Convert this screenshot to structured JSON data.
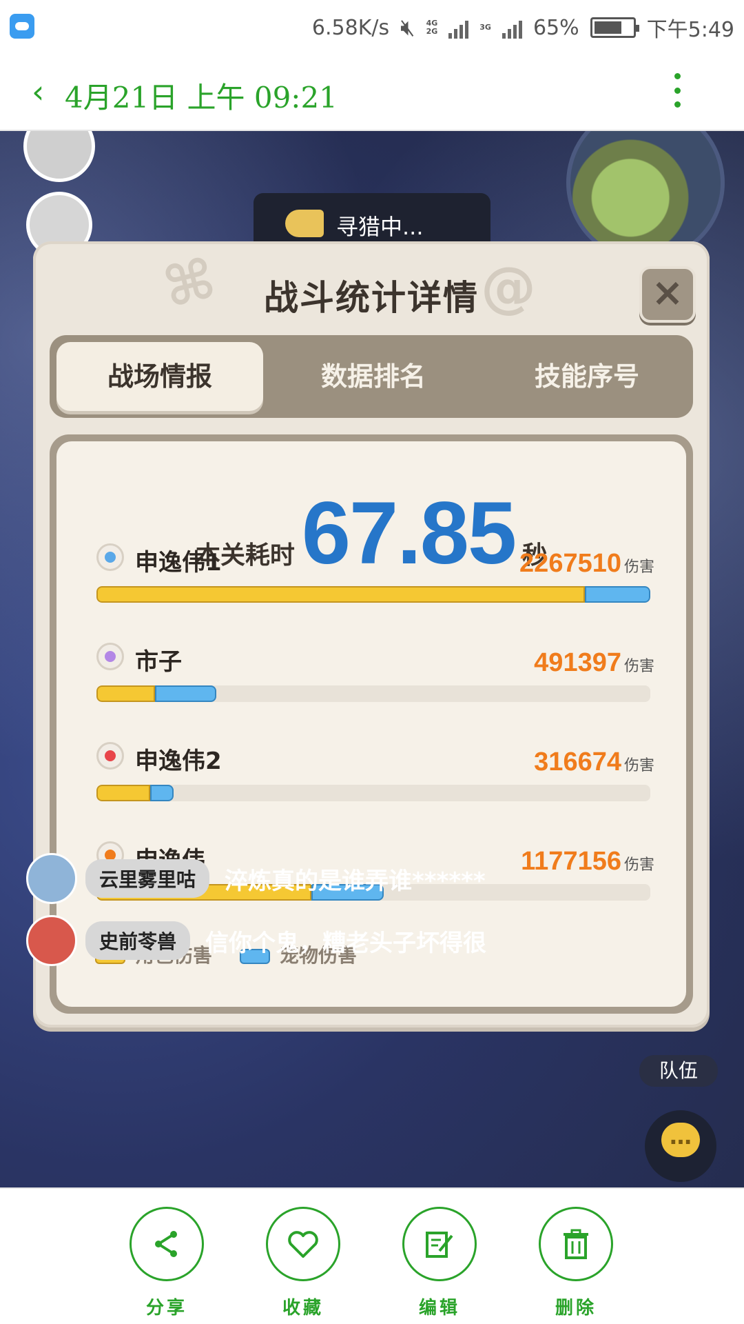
{
  "status_bar": {
    "net_speed": "6.58K/s",
    "net_type_a": "4G",
    "net_type_b": "2G",
    "net_type_c": "3G",
    "battery": "65%",
    "time": "下午5:49",
    "accent": "#555555"
  },
  "header": {
    "back_icon": "chevron-left-icon",
    "title": "4月21日 上午 09:21",
    "more_icon": "more-vertical-icon",
    "color": "#2aa32a"
  },
  "game": {
    "hunting_label": "寻猎中...",
    "team_label": "队伍",
    "chat": [
      {
        "name": "云里雾里咕",
        "message": "淬炼真的是谁弄谁******"
      },
      {
        "name": "史前苓兽",
        "message": "信你个鬼，糟老头子坏得很"
      }
    ]
  },
  "dialog": {
    "title": "战斗统计详情",
    "close_icon": "close-icon",
    "tabs": [
      {
        "label": "战场情报",
        "active": true
      },
      {
        "label": "数据排名",
        "active": false
      },
      {
        "label": "技能序号",
        "active": false
      }
    ],
    "time_label": "本关耗时",
    "time_value": "67.85",
    "time_unit": "秒",
    "damage_suffix": "伤害",
    "legend": {
      "character": "角色伤害",
      "pet": "宠物伤害",
      "character_color": "#f5c833",
      "pet_color": "#5fb6ef"
    }
  },
  "chart_data": {
    "type": "bar",
    "title": "",
    "categories": [
      "申逸伟1",
      "市子",
      "申逸伟2",
      "申逸伟"
    ],
    "series": [
      {
        "name": "角色伤害",
        "values": [
          2000000,
          240000,
          220000,
          880000
        ]
      },
      {
        "name": "宠物伤害",
        "values": [
          267510,
          251397,
          96674,
          297156
        ]
      }
    ],
    "totals": [
      "2267510",
      "491397",
      "316674",
      "1177156"
    ],
    "total_values": [
      2267510,
      491397,
      316674,
      1177156
    ],
    "xlim": [
      0,
      2267510
    ],
    "icon_colors": [
      "#5aa8e8",
      "#b387e6",
      "#e8454a",
      "#f07c1c"
    ],
    "icon_names": [
      "blade-class-icon",
      "orb-class-icon",
      "fire-swirl-class-icon",
      "flame-class-icon"
    ]
  },
  "bottom_bar": {
    "actions": [
      {
        "label": "分享",
        "icon": "share-icon"
      },
      {
        "label": "收藏",
        "icon": "heart-icon"
      },
      {
        "label": "编辑",
        "icon": "edit-icon"
      },
      {
        "label": "删除",
        "icon": "trash-icon"
      }
    ],
    "color": "#2aa32a"
  }
}
